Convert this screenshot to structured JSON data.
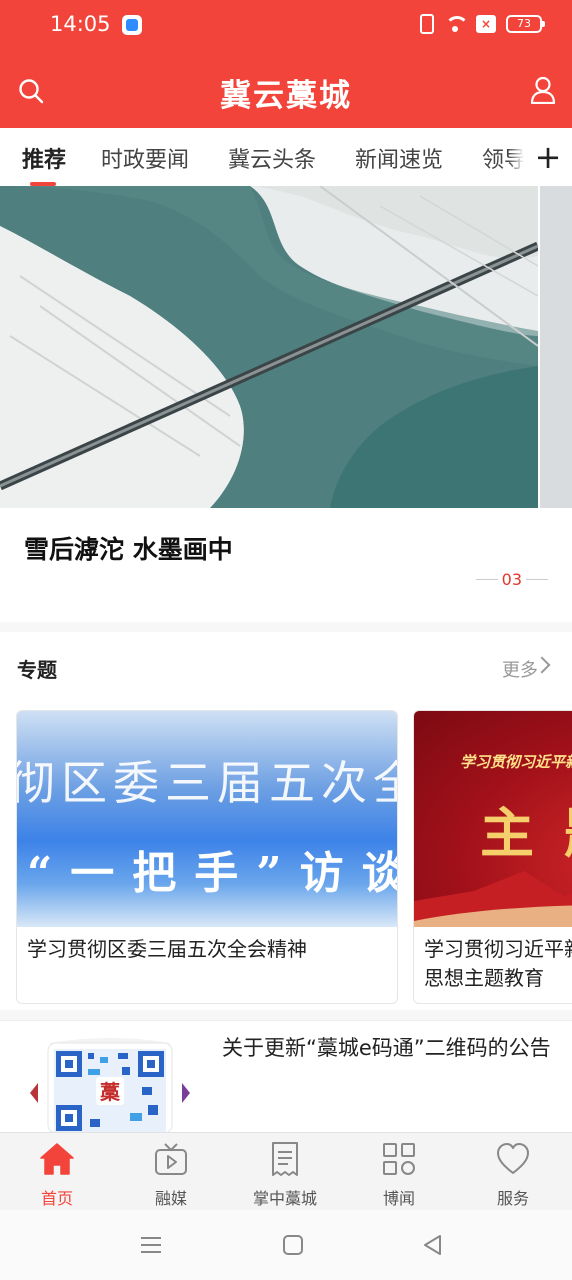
{
  "status_bar": {
    "time": "14:05",
    "battery": "73"
  },
  "header": {
    "title": "冀云藁城"
  },
  "tabs": [
    {
      "label": "推荐",
      "active": true
    },
    {
      "label": "时政要闻"
    },
    {
      "label": "冀云头条"
    },
    {
      "label": "新闻速览"
    },
    {
      "label": "领导"
    }
  ],
  "tabs_add": "+",
  "banner": {
    "title": "雪后滹沱 水墨画中",
    "page": "03"
  },
  "topics": {
    "title": "专题",
    "more": "更多",
    "items": [
      {
        "label": "学习贯彻区委三届五次全会精神",
        "art_line1": "彻区委三届五次全",
        "art_line2": "“一把手”访谈"
      },
      {
        "label": "学习贯彻习近平新时代中国特色社会主义思想主题教育",
        "art_line1": "学习贯彻习近平新",
        "art_line2": "主题"
      }
    ]
  },
  "notice": {
    "title": "关于更新“藁城e码通”二维码的公告",
    "thumb_text": "藁"
  },
  "bottom_nav": [
    {
      "label": "首页",
      "icon": "home-icon",
      "active": true
    },
    {
      "label": "融媒",
      "icon": "tv-play-icon"
    },
    {
      "label": "掌中藁城",
      "icon": "receipt-icon"
    },
    {
      "label": "博闻",
      "icon": "grid-icon"
    },
    {
      "label": "服务",
      "icon": "heart-icon"
    }
  ],
  "colors": {
    "brand": "#f2443a",
    "active": "#f2443a"
  }
}
